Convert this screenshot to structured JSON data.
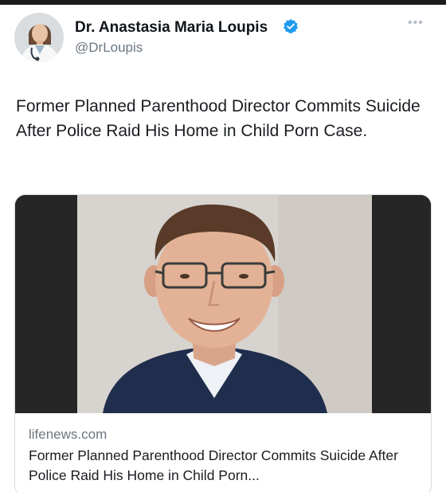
{
  "author": {
    "name": "Dr. Anastasia Maria Loupis",
    "handle": "@DrLoupis",
    "verified": true,
    "verified_color": "#1d9bf0"
  },
  "more_menu": {
    "icon": "more-horizontal-icon",
    "label": "•••"
  },
  "tweet": {
    "text": "Former Planned Parenthood Director Commits Suicide After Police Raid His Home in Child Porn Case."
  },
  "link_card": {
    "domain": "lifenews.com",
    "title": "Former Planned Parenthood Director Commits Suicide After Police Raid His Home in Child Porn..."
  },
  "colors": {
    "text": "#0f1419",
    "secondary_text": "#6b7680",
    "card_border": "#d8dde1"
  }
}
